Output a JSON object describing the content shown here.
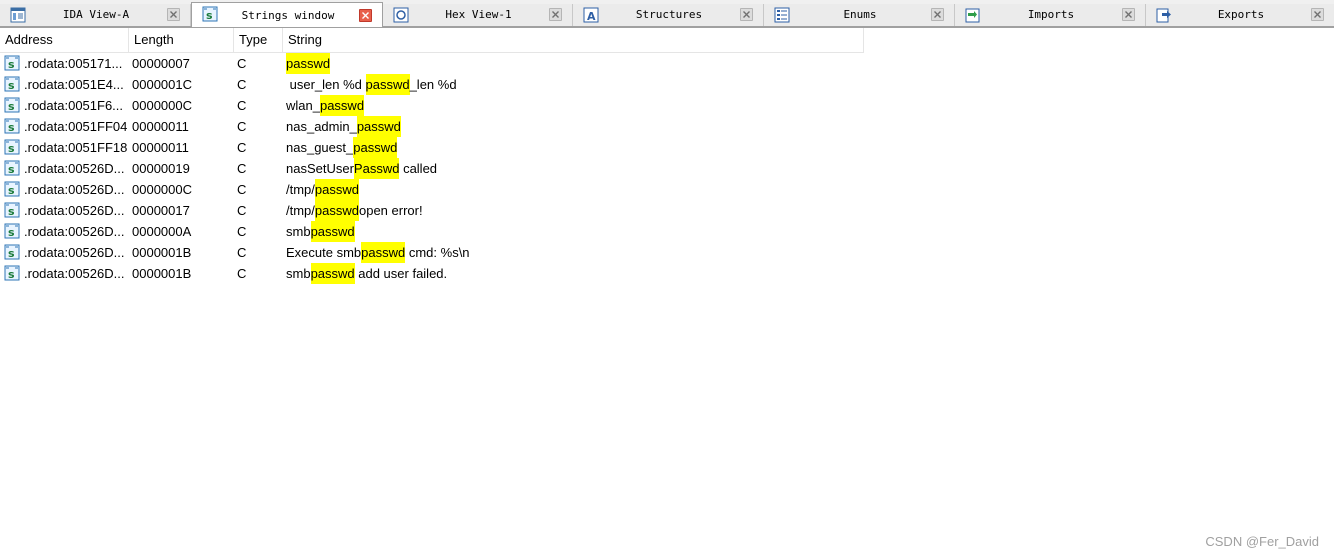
{
  "tabs": [
    {
      "label": "IDA View-A",
      "icon": "ida-view-icon",
      "active": false
    },
    {
      "label": "Strings window",
      "icon": "strings-icon",
      "active": true
    },
    {
      "label": "Hex View-1",
      "icon": "hex-view-icon",
      "active": false
    },
    {
      "label": "Structures",
      "icon": "structures-icon",
      "active": false
    },
    {
      "label": "Enums",
      "icon": "enums-icon",
      "active": false
    },
    {
      "label": "Imports",
      "icon": "imports-icon",
      "active": false
    },
    {
      "label": "Exports",
      "icon": "exports-icon",
      "active": false
    }
  ],
  "columns": {
    "address": "Address",
    "length": "Length",
    "type": "Type",
    "string": "String"
  },
  "highlight_term": "passwd",
  "highlight_color": "#ffff00",
  "rows": [
    {
      "address": ".rodata:005171...",
      "length": "00000007",
      "type": "C",
      "pre": "",
      "match": "passwd",
      "post": ""
    },
    {
      "address": ".rodata:0051E4...",
      "length": "0000001C",
      "type": "C",
      "pre": " user_len %d ",
      "match": "passwd",
      "post": "_len %d"
    },
    {
      "address": ".rodata:0051F6...",
      "length": "0000000C",
      "type": "C",
      "pre": "wlan_",
      "match": "passwd",
      "post": ""
    },
    {
      "address": ".rodata:0051FF04",
      "length": "00000011",
      "type": "C",
      "pre": "nas_admin_",
      "match": "passwd",
      "post": ""
    },
    {
      "address": ".rodata:0051FF18",
      "length": "00000011",
      "type": "C",
      "pre": "nas_guest_",
      "match": "passwd",
      "post": ""
    },
    {
      "address": ".rodata:00526D...",
      "length": "00000019",
      "type": "C",
      "pre": "nasSetUser",
      "match": "Passwd",
      "post": " called"
    },
    {
      "address": ".rodata:00526D...",
      "length": "0000000C",
      "type": "C",
      "pre": "/tmp/",
      "match": "passwd",
      "post": ""
    },
    {
      "address": ".rodata:00526D...",
      "length": "00000017",
      "type": "C",
      "pre": "/tmp/",
      "match": "passwd",
      "post": "open error!"
    },
    {
      "address": ".rodata:00526D...",
      "length": "0000000A",
      "type": "C",
      "pre": "smb",
      "match": "passwd",
      "post": ""
    },
    {
      "address": ".rodata:00526D...",
      "length": "0000001B",
      "type": "C",
      "pre": "Execute smb",
      "match": "passwd",
      "post": " cmd: %s\\n"
    },
    {
      "address": ".rodata:00526D...",
      "length": "0000001B",
      "type": "C",
      "pre": "smb",
      "match": "passwd",
      "post": " add user failed."
    }
  ],
  "watermark": "CSDN @Fer_David"
}
